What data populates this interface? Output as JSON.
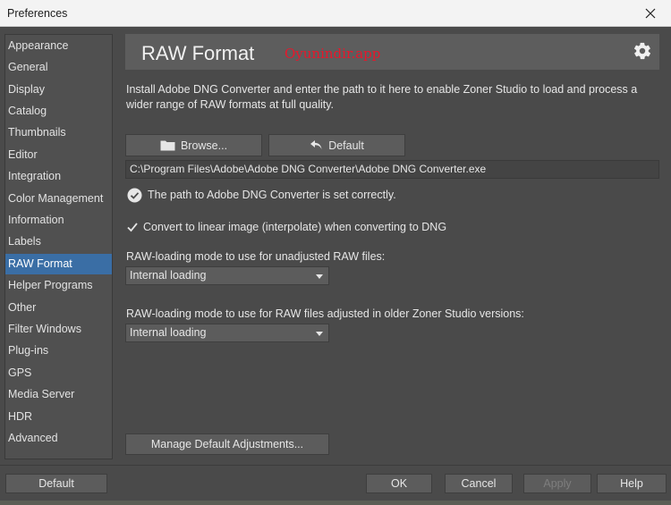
{
  "window": {
    "title": "Preferences"
  },
  "sidebar": {
    "items": [
      {
        "label": "Appearance"
      },
      {
        "label": "General"
      },
      {
        "label": "Display"
      },
      {
        "label": "Catalog"
      },
      {
        "label": "Thumbnails"
      },
      {
        "label": "Editor"
      },
      {
        "label": "Integration"
      },
      {
        "label": "Color Management"
      },
      {
        "label": "Information"
      },
      {
        "label": "Labels"
      },
      {
        "label": "RAW Format",
        "active": true
      },
      {
        "label": "Helper Programs"
      },
      {
        "label": "Other"
      },
      {
        "label": "Filter Windows"
      },
      {
        "label": "Plug-ins"
      },
      {
        "label": "GPS"
      },
      {
        "label": "Media Server"
      },
      {
        "label": "HDR"
      },
      {
        "label": "Advanced"
      }
    ]
  },
  "main": {
    "title": "RAW Format",
    "watermark": "Oyunindir.app",
    "description": "Install Adobe DNG Converter and enter the path to it here to enable Zoner Studio to load and process a wider range of RAW formats at full quality.",
    "browse_label": "Browse...",
    "default_label": "Default",
    "converter_path": "C:\\Program Files\\Adobe\\Adobe DNG Converter\\Adobe DNG Converter.exe",
    "status_text": "The path to Adobe DNG Converter is set correctly.",
    "linear_checkbox": {
      "label": "Convert to linear image (interpolate) when converting to DNG",
      "checked": true
    },
    "unadjusted_label": "RAW-loading mode to use for unadjusted RAW files:",
    "unadjusted_value": "Internal loading",
    "adjusted_label": "RAW-loading mode to use for RAW files adjusted in older Zoner Studio versions:",
    "adjusted_value": "Internal loading",
    "manage_label": "Manage Default Adjustments..."
  },
  "footer": {
    "default_label": "Default",
    "ok_label": "OK",
    "cancel_label": "Cancel",
    "apply_label": "Apply",
    "help_label": "Help"
  },
  "colors": {
    "accent": "#3a6ea5",
    "watermark": "#e8162b",
    "panel": "#4a4a4a"
  },
  "icons": [
    "close-icon",
    "gear-icon",
    "folder-icon",
    "undo-arrow-icon",
    "checkmark-circle-icon",
    "checkbox-checked-icon",
    "dropdown-arrow-icon"
  ]
}
